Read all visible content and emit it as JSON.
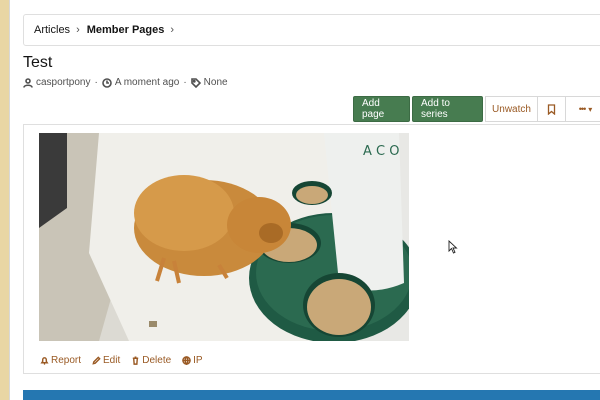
{
  "breadcrumb": {
    "items": [
      {
        "label": "Articles"
      },
      {
        "label": "Member Pages"
      }
    ]
  },
  "article": {
    "title": "Test",
    "author": "casportpony",
    "time": "A moment ago",
    "tags": "None"
  },
  "actions": {
    "add_page": "Add page",
    "add_to_series": "Add to series",
    "unwatch": "Unwatch",
    "more": "•••"
  },
  "footer": {
    "report": "Report",
    "edit": "Edit",
    "delete": "Delete",
    "ip": "IP"
  },
  "colors": {
    "accent_green": "#477c50",
    "link_brown": "#9a5a24",
    "footer_blue": "#2577b1",
    "background_gold": "#e9d6a4"
  }
}
